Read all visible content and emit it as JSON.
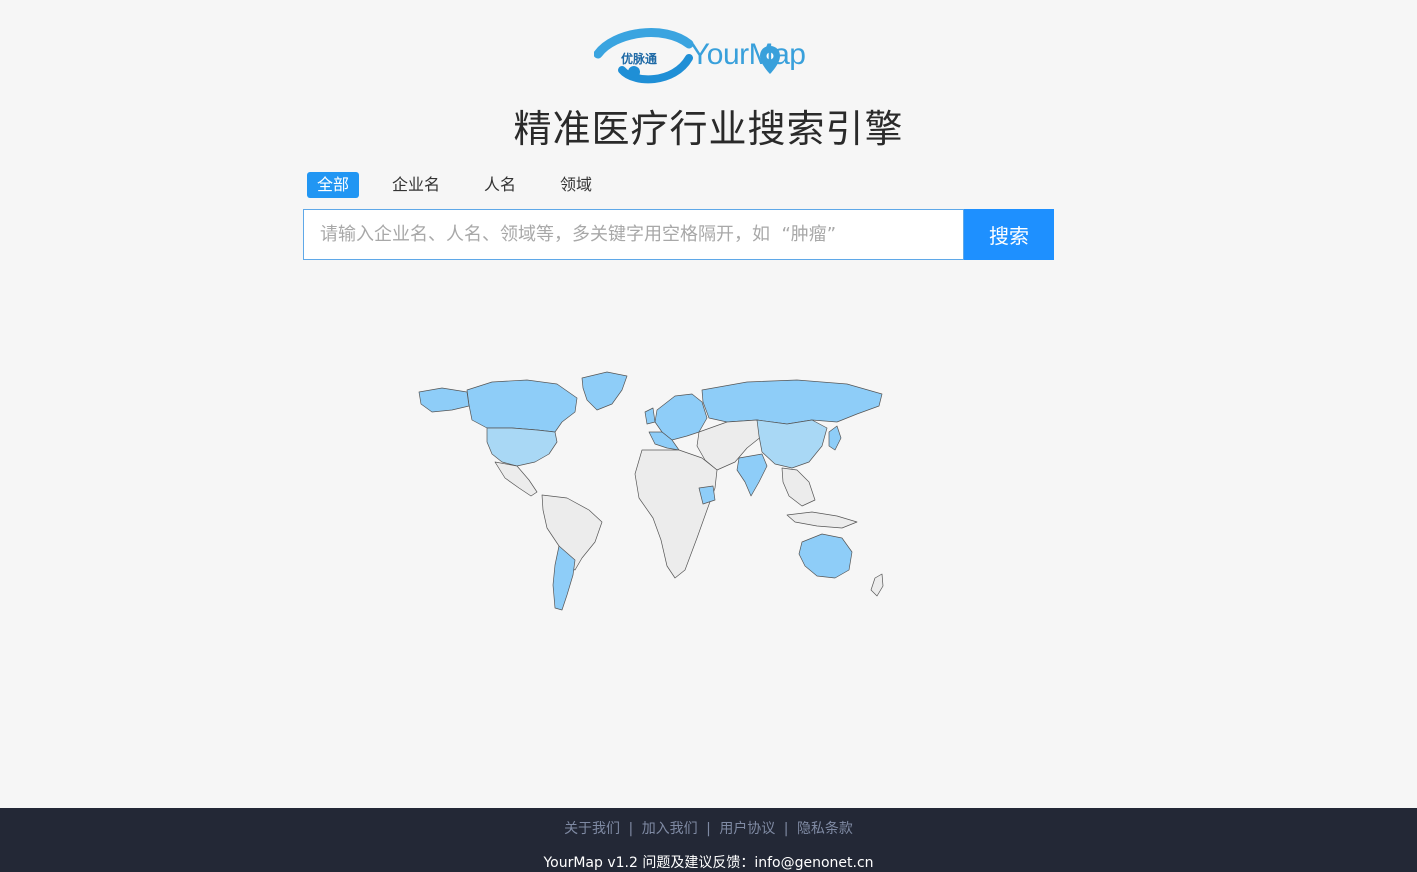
{
  "logo": {
    "badge": "优脉通",
    "text": "YourMap"
  },
  "title": "精准医疗行业搜索引擎",
  "tabs": [
    {
      "label": "全部",
      "active": true
    },
    {
      "label": "企业名",
      "active": false
    },
    {
      "label": "人名",
      "active": false
    },
    {
      "label": "领域",
      "active": false
    }
  ],
  "search": {
    "placeholder": "请输入企业名、人名、领域等，多关键字用空格隔开，如  “肿瘤”",
    "value": "",
    "button_label": "搜索"
  },
  "footer": {
    "links": [
      "关于我们",
      "加入我们",
      "用户协议",
      "隐私条款"
    ],
    "separator": "|",
    "copyright": "YourMap v1.2 问题及建议反馈：info@genonet.cn"
  },
  "colors": {
    "accent": "#1e90ff",
    "map_highlight": "#8ecdf8",
    "map_highlight_light": "#a9d8f5",
    "map_default": "#ececec",
    "map_border": "#555555",
    "footer_bg": "#232836"
  }
}
